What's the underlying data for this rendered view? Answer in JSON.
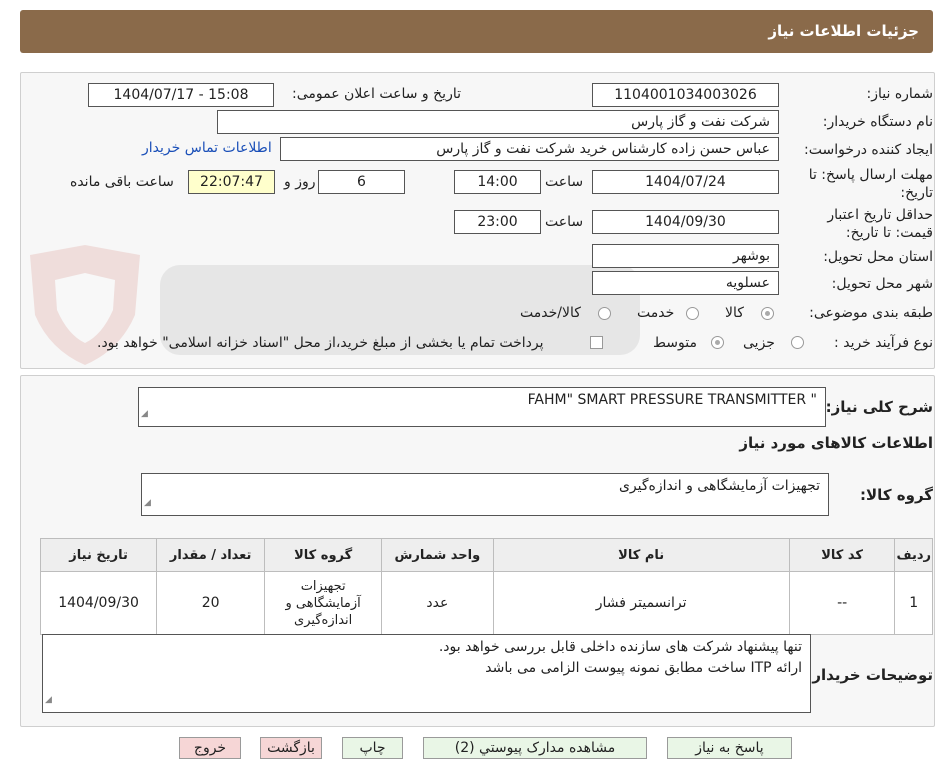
{
  "header": {
    "title": "جزئیات اطلاعات نیاز"
  },
  "form": {
    "need_number_label": "شماره نیاز:",
    "need_number": "1104001034003026",
    "announce_label": "تاریخ و ساعت اعلان عمومی:",
    "announce_value": "1404/07/17 - 15:08",
    "buyer_label": "نام دستگاه خریدار:",
    "buyer_value": "شرکت نفت و گاز پارس",
    "creator_label": "ایجاد کننده درخواست:",
    "creator_value": "عباس حسن زاده کارشناس خرید شرکت نفت و گاز پارس",
    "contact_link": "اطلاعات تماس خریدار",
    "deadline_label": "مهلت ارسال پاسخ: تا تاریخ:",
    "deadline_date": "1404/07/24",
    "time_label": "ساعت",
    "deadline_time": "14:00",
    "days_value": "6",
    "days_label": "روز و",
    "remaining_time": "22:07:47",
    "remaining_label": "ساعت باقی مانده",
    "validity_label": "حداقل تاریخ اعتبار قیمت: تا تاریخ:",
    "validity_date": "1404/09/30",
    "validity_time": "23:00",
    "province_label": "استان محل تحویل:",
    "province_value": "بوشهر",
    "city_label": "شهر محل تحویل:",
    "city_value": "عسلویه",
    "category_label": "طبقه بندی موضوعی:",
    "category_options": [
      "کالا",
      "خدمت",
      "کالا/خدمت"
    ],
    "process_label": "نوع فرآیند خرید :",
    "process_options": [
      "جزیی",
      "متوسط"
    ],
    "payment_note": "پرداخت تمام یا بخشی از مبلغ خرید،از محل \"اسناد خزانه اسلامی\" خواهد بود."
  },
  "details": {
    "summary_label": "شرح کلی نیاز:",
    "summary_value": "FAHM\" SMART PRESSURE TRANSMITTER \"",
    "goods_info_title": "اطلاعات کالاهای مورد نیاز",
    "goods_group_label": "گروه کالا:",
    "goods_group_value": "تجهیزات آزمایشگاهی و اندازه‌گیری"
  },
  "table": {
    "headers": [
      "ردیف",
      "کد کالا",
      "نام کالا",
      "واحد شمارش",
      "گروه کالا",
      "تعداد / مقدار",
      "تاریخ نیاز"
    ],
    "rows": [
      [
        "1",
        "--",
        "ترانسمیتر فشار",
        "عدد",
        "تجهیزات آزمایشگاهی و اندازه‌گیری",
        "20",
        "1404/09/30"
      ]
    ]
  },
  "notes": {
    "label": "توضیحات خریدار:",
    "line1": "تنها پیشنهاد شرکت های سازنده داخلی قابل بررسی خواهد بود.",
    "line2": "ارائه ITP ساخت مطابق نمونه پیوست الزامی می باشد"
  },
  "buttons": {
    "reply": "پاسخ به نیاز",
    "attachments": "مشاهده مدارک پیوستي (2)",
    "print": "چاپ",
    "back": "بازگشت",
    "exit": "خروج"
  },
  "colors": {
    "header_bg": "#8a6a4a",
    "link": "#1a4fb8",
    "timer_bg": "#ffffcc",
    "btn_green": "#e9f6e6",
    "btn_pink": "#f6d6d6"
  }
}
